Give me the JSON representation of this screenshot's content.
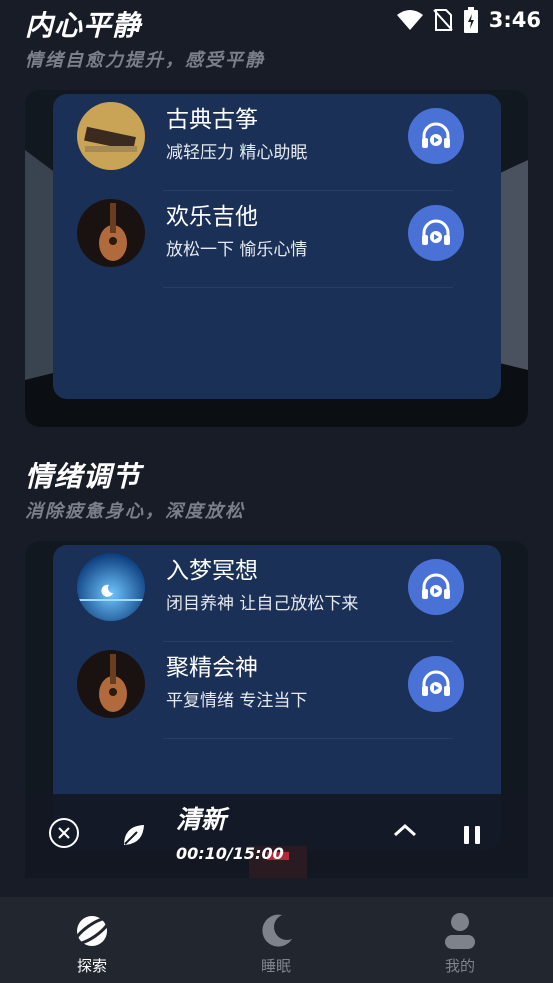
{
  "status": {
    "time": "3:46"
  },
  "section1": {
    "title": "内心平静",
    "subtitle": "情绪自愈力提升，感受平静"
  },
  "section2": {
    "title": "情绪调节",
    "subtitle": "消除疲惫身心，深度放松"
  },
  "panel1": {
    "tracks": [
      {
        "name": "古典古筝",
        "desc": "减轻压力  精心助眠",
        "thumb": "guzheng"
      },
      {
        "name": "欢乐吉他",
        "desc": "放松一下  愉乐心情",
        "thumb": "guitar"
      }
    ]
  },
  "panel2": {
    "tracks": [
      {
        "name": "入梦冥想",
        "desc": "闭目养神  让自己放松下来",
        "thumb": "moon-lake"
      },
      {
        "name": "聚精会神",
        "desc": "平复情绪  专注当下",
        "thumb": "guitar"
      }
    ]
  },
  "player": {
    "title": "清新",
    "time": "00:10/15:00"
  },
  "tabs": [
    {
      "label": "探索",
      "icon": "planet-icon",
      "active": true
    },
    {
      "label": "睡眠",
      "icon": "moon-icon",
      "active": false
    },
    {
      "label": "我的",
      "icon": "person-icon",
      "active": false
    }
  ],
  "colors": {
    "accent": "#4a72d6",
    "panel": "#1b3056",
    "tab_active": "#ffffff",
    "tab_inactive": "#7d828b"
  }
}
